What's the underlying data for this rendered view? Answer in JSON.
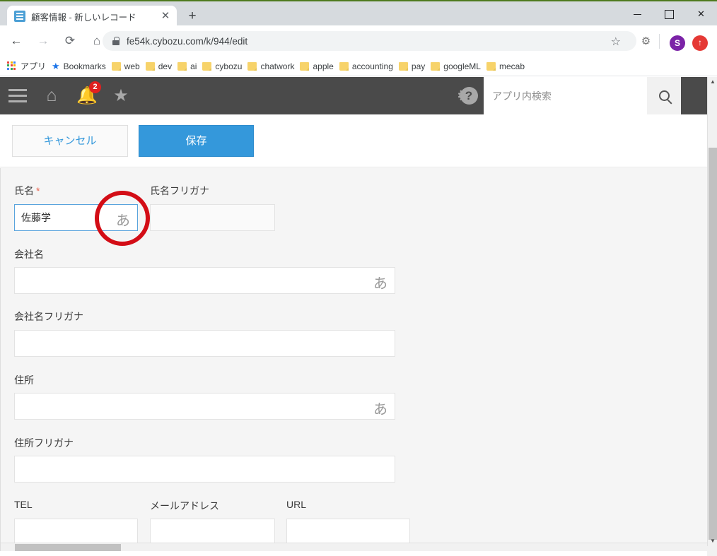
{
  "browser": {
    "tab": {
      "title": "顧客情報 - 新しいレコード",
      "favicon": "list-app-icon",
      "close": "✕"
    },
    "newtab_label": "+",
    "window_controls": {
      "minimize": "minimize-icon",
      "maximize": "maximize-icon",
      "close": "✕"
    },
    "nav": {
      "back": "←",
      "forward": "→",
      "reload": "⟳",
      "home": "⌂"
    },
    "omnibox": {
      "url": "fe54k.cybozu.com/k/944/edit",
      "lock": "lock-icon",
      "star": "☆"
    },
    "extensions": {
      "gear": "⚙"
    },
    "profile": {
      "initial": "S"
    },
    "update_button": {
      "glyph": "↑"
    },
    "bookmarks": [
      {
        "label": "アプリ",
        "icon": "apps-grid-icon"
      },
      {
        "label": "Bookmarks",
        "icon": "star-icon"
      },
      {
        "label": "web",
        "icon": "folder-icon"
      },
      {
        "label": "dev",
        "icon": "folder-icon"
      },
      {
        "label": "ai",
        "icon": "folder-icon"
      },
      {
        "label": "cybozu",
        "icon": "folder-icon"
      },
      {
        "label": "chatwork",
        "icon": "folder-icon"
      },
      {
        "label": "apple",
        "icon": "folder-icon"
      },
      {
        "label": "accounting",
        "icon": "folder-icon"
      },
      {
        "label": "pay",
        "icon": "folder-icon"
      },
      {
        "label": "googleML",
        "icon": "folder-icon"
      },
      {
        "label": "mecab",
        "icon": "folder-icon"
      }
    ]
  },
  "kintone_header": {
    "menu_icon": "hamburger-icon",
    "home_icon": "home-icon",
    "notification_icon": "bell-icon",
    "notification_count": "2",
    "favorite_icon": "star-icon",
    "settings_icon": "gear-icon",
    "help_icon": "?",
    "search_placeholder": "アプリ内検索",
    "search_value": "",
    "search_button_icon": "search-icon"
  },
  "actions": {
    "cancel_label": "キャンセル",
    "save_label": "保存"
  },
  "form": {
    "fields": [
      {
        "label": "氏名",
        "required": "*",
        "value": "佐藤学",
        "ime": "あ",
        "focused": true
      },
      {
        "label": "氏名フリガナ",
        "value": "",
        "ime": ""
      },
      {
        "label": "会社名",
        "value": "",
        "ime": "あ"
      },
      {
        "label": "会社名フリガナ",
        "value": "",
        "ime": ""
      },
      {
        "label": "住所",
        "value": "",
        "ime": "あ"
      },
      {
        "label": "住所フリガナ",
        "value": "",
        "ime": ""
      },
      {
        "label": "TEL",
        "value": "",
        "ime": ""
      },
      {
        "label": "メールアドレス",
        "value": "",
        "ime": ""
      },
      {
        "label": "URL",
        "value": "",
        "ime": ""
      }
    ]
  },
  "annotation": {
    "shape": "red-circle-highlight"
  },
  "colors": {
    "accent_blue": "#3498db",
    "header_dark": "#4a4a4a",
    "badge_red": "#e02020",
    "annotation_red": "#d30d16",
    "required_red": "#e8604c"
  }
}
